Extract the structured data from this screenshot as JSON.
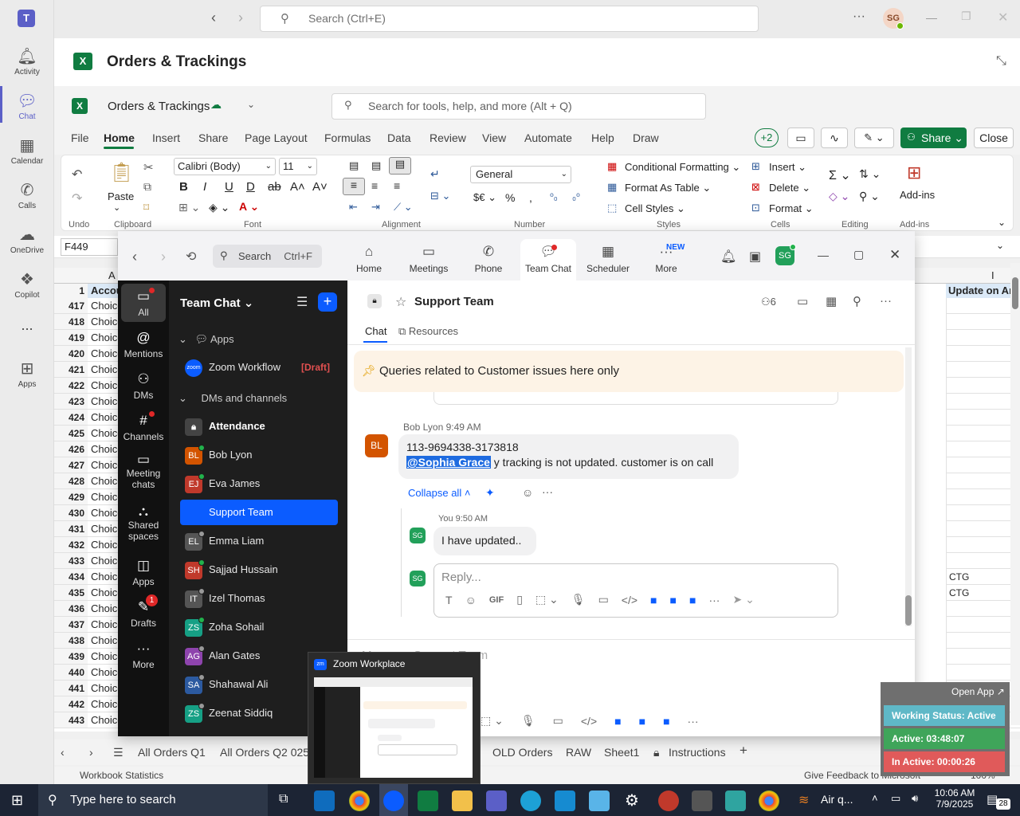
{
  "teams": {
    "search_placeholder": "Search (Ctrl+E)",
    "user_initials": "SG",
    "rail": [
      {
        "label": "Activity",
        "icon": "bell-icon"
      },
      {
        "label": "Chat",
        "icon": "chat-icon"
      },
      {
        "label": "Calendar",
        "icon": "calendar-icon"
      },
      {
        "label": "Calls",
        "icon": "phone-icon"
      },
      {
        "label": "OneDrive",
        "icon": "cloud-icon"
      },
      {
        "label": "Copilot",
        "icon": "copilot-icon"
      },
      {
        "label": "...",
        "icon": "more-icon"
      },
      {
        "label": "Apps",
        "icon": "apps-icon"
      }
    ]
  },
  "excel": {
    "title": "Orders & Trackings",
    "workbook_name": "Orders & Trackings",
    "search_placeholder": "Search for tools, help, and more (Alt + Q)",
    "tabs": [
      "File",
      "Home",
      "Insert",
      "Share",
      "Page Layout",
      "Formulas",
      "Data",
      "Review",
      "View",
      "Automate",
      "Help",
      "Draw"
    ],
    "collab_count": "+2",
    "share_label": "Share",
    "close_label": "Close",
    "ribbon": {
      "undo_group": "Undo",
      "clipboard_group": "Clipboard",
      "paste_label": "Paste",
      "font_name": "Calibri (Body)",
      "font_size": "11",
      "font_group": "Font",
      "alignment_group": "Alignment",
      "number_format": "General",
      "number_group": "Number",
      "cond_format": "Conditional Formatting",
      "format_table": "Format As Table",
      "cell_styles": "Cell Styles",
      "styles_group": "Styles",
      "insert": "Insert",
      "delete": "Delete",
      "format": "Format",
      "cells_group": "Cells",
      "editing_group": "Editing",
      "addins_label": "Add-ins",
      "addins_group": "Add-ins"
    },
    "name_box": "F449",
    "col_a": "A",
    "col_i": "I",
    "header_row_num": "1",
    "header_a": "Accou",
    "header_i": "Update on Ar",
    "rows": [
      {
        "n": "417",
        "a": "Choice",
        "i": ""
      },
      {
        "n": "418",
        "a": "Choice",
        "i": ""
      },
      {
        "n": "419",
        "a": "Choice",
        "i": ""
      },
      {
        "n": "420",
        "a": "Choice",
        "i": ""
      },
      {
        "n": "421",
        "a": "Choice",
        "i": ""
      },
      {
        "n": "422",
        "a": "Choice",
        "i": ""
      },
      {
        "n": "423",
        "a": "Choice",
        "i": ""
      },
      {
        "n": "424",
        "a": "Choice",
        "i": ""
      },
      {
        "n": "425",
        "a": "Choice",
        "i": ""
      },
      {
        "n": "426",
        "a": "Choice",
        "i": ""
      },
      {
        "n": "427",
        "a": "Choice",
        "i": ""
      },
      {
        "n": "428",
        "a": "Choice",
        "i": ""
      },
      {
        "n": "429",
        "a": "Choice",
        "i": ""
      },
      {
        "n": "430",
        "a": "Choice",
        "i": ""
      },
      {
        "n": "431",
        "a": "Choice",
        "i": ""
      },
      {
        "n": "432",
        "a": "Choice",
        "i": ""
      },
      {
        "n": "433",
        "a": "Choice",
        "i": ""
      },
      {
        "n": "434",
        "a": "Choice",
        "i": "CTG"
      },
      {
        "n": "435",
        "a": "Choice",
        "i": "CTG"
      },
      {
        "n": "436",
        "a": "Choice",
        "i": ""
      },
      {
        "n": "437",
        "a": "Choice",
        "i": ""
      },
      {
        "n": "438",
        "a": "Choice",
        "i": ""
      },
      {
        "n": "439",
        "a": "Choice",
        "i": ""
      },
      {
        "n": "440",
        "a": "Choice",
        "i": ""
      },
      {
        "n": "441",
        "a": "Choice",
        "i": ""
      },
      {
        "n": "442",
        "a": "Choice",
        "i": ""
      },
      {
        "n": "443",
        "a": "Choice",
        "i": ""
      }
    ],
    "sheet_tabs": [
      "All Orders Q1",
      "All Orders Q2 025",
      "OLD Orders",
      "RAW",
      "Sheet1",
      "Instructions"
    ],
    "status_left": "Workbook Statistics",
    "status_right": "Give Feedback to Microsoft",
    "zoom_level": "100%"
  },
  "zoom": {
    "search_label": "Search",
    "search_shortcut": "Ctrl+F",
    "nav": [
      "Home",
      "Meetings",
      "Phone",
      "Team Chat",
      "Scheduler",
      "More"
    ],
    "new_badge": "NEW",
    "user_initials": "SG",
    "left": [
      "All",
      "Mentions",
      "DMs",
      "Channels",
      "Meeting chats",
      "Shared spaces",
      "Apps",
      "Drafts",
      "More"
    ],
    "drafts_badge": "1",
    "list_title": "Team Chat",
    "sections": {
      "apps": "Apps",
      "dms": "DMs and channels"
    },
    "workflow": {
      "name": "Zoom Workflow",
      "tag": "[Draft]"
    },
    "contacts": [
      {
        "initials": "",
        "name": "Attendance",
        "color": "#444444"
      },
      {
        "initials": "BL",
        "name": "Bob Lyon",
        "color": "#d35400"
      },
      {
        "initials": "EJ",
        "name": "Eva James",
        "color": "#c0392b"
      },
      {
        "initials": "",
        "name": "Support Team",
        "color": "#0b5cff"
      },
      {
        "initials": "EL",
        "name": "Emma Liam",
        "color": "#555555"
      },
      {
        "initials": "SH",
        "name": "Sajjad Hussain",
        "color": "#c0392b"
      },
      {
        "initials": "IT",
        "name": "Izel Thomas",
        "color": "#555555"
      },
      {
        "initials": "ZS",
        "name": "Zoha Sohail",
        "color": "#16a085"
      },
      {
        "initials": "AG",
        "name": "Alan Gates",
        "color": "#8e44ad"
      },
      {
        "initials": "SA",
        "name": "Shahawal Ali",
        "color": "#2c5aa0"
      },
      {
        "initials": "ZS",
        "name": "Zeenat Siddiq",
        "color": "#16a085"
      }
    ],
    "channel_title": "Support Team",
    "member_count": "6",
    "chat_tabs": [
      "Chat",
      "Resources"
    ],
    "pinned": "Queries related to Customer issues here only",
    "msg1": {
      "author": "Bob Lyon",
      "time": "9:49 AM",
      "initials": "BL",
      "line1": "113-9694338-3173818",
      "mention": "@Sophia Grace",
      "line2": " y tracking is not updated. customer is on call"
    },
    "collapse_label": "Collapse all",
    "msg2": {
      "author": "You",
      "time": "9:50 AM",
      "initials": "SG",
      "text": "I have updated.."
    },
    "reply_placeholder": "Reply...",
    "bottom_hint": "Message Support Team"
  },
  "taskbar_preview": {
    "title": "Zoom Workplace"
  },
  "activity": {
    "open_app": "Open App",
    "status": "Working Status: Active",
    "active": "Active: 03:48:07",
    "inactive": "In Active: 00:00:26"
  },
  "taskbar": {
    "search_placeholder": "Type here to search",
    "weather": "Air q...",
    "time": "10:06 AM",
    "date": "7/9/2025",
    "notif_count": "28"
  }
}
